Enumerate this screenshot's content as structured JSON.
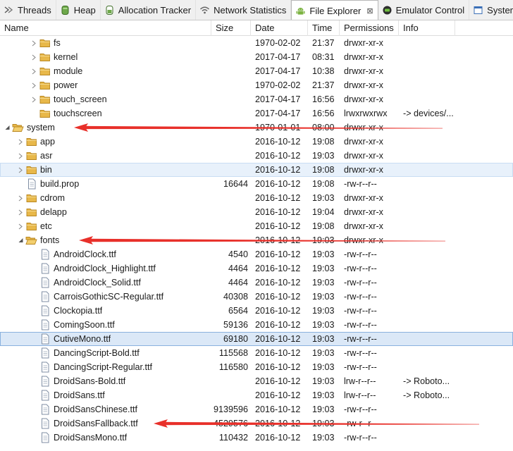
{
  "tabs": [
    {
      "label": "Threads",
      "icon": "threads-icon",
      "active": false,
      "closable": false
    },
    {
      "label": "Heap",
      "icon": "heap-icon",
      "active": false,
      "closable": false
    },
    {
      "label": "Allocation Tracker",
      "icon": "allocation-tracker-icon",
      "active": false,
      "closable": false
    },
    {
      "label": "Network Statistics",
      "icon": "wifi-icon",
      "active": false,
      "closable": false
    },
    {
      "label": "File Explorer",
      "icon": "android-icon",
      "active": true,
      "closable": true,
      "close_glyph": "⊠"
    },
    {
      "label": "Emulator Control",
      "icon": "emulator-icon",
      "active": false,
      "closable": false
    },
    {
      "label": "System Informati",
      "icon": "system-info-icon",
      "active": false,
      "closable": false
    }
  ],
  "columns": {
    "name": "Name",
    "size": "Size",
    "date": "Date",
    "time": "Time",
    "permissions": "Permissions",
    "info": "Info"
  },
  "rows": [
    {
      "name": "fs",
      "type": "folder",
      "depth": 2,
      "expand": "collapsed",
      "size": "",
      "date": "1970-02-02",
      "time": "21:37",
      "perm": "drwxr-xr-x",
      "info": ""
    },
    {
      "name": "kernel",
      "type": "folder",
      "depth": 2,
      "expand": "collapsed",
      "size": "",
      "date": "2017-04-17",
      "time": "08:31",
      "perm": "drwxr-xr-x",
      "info": ""
    },
    {
      "name": "module",
      "type": "folder",
      "depth": 2,
      "expand": "collapsed",
      "size": "",
      "date": "2017-04-17",
      "time": "10:38",
      "perm": "drwxr-xr-x",
      "info": ""
    },
    {
      "name": "power",
      "type": "folder",
      "depth": 2,
      "expand": "collapsed",
      "size": "",
      "date": "1970-02-02",
      "time": "21:37",
      "perm": "drwxr-xr-x",
      "info": ""
    },
    {
      "name": "touch_screen",
      "type": "folder",
      "depth": 2,
      "expand": "collapsed",
      "size": "",
      "date": "2017-04-17",
      "time": "16:56",
      "perm": "drwxr-xr-x",
      "info": ""
    },
    {
      "name": "touchscreen",
      "type": "folder",
      "depth": 2,
      "expand": "none",
      "size": "",
      "date": "2017-04-17",
      "time": "16:56",
      "perm": "lrwxrwxrwx",
      "info": "-> devices/..."
    },
    {
      "name": "system",
      "type": "folder",
      "depth": 0,
      "expand": "expanded",
      "size": "",
      "date": "1970-01-01",
      "time": "08:00",
      "perm": "drwxr-xr-x",
      "info": ""
    },
    {
      "name": "app",
      "type": "folder",
      "depth": 1,
      "expand": "collapsed",
      "size": "",
      "date": "2016-10-12",
      "time": "19:08",
      "perm": "drwxr-xr-x",
      "info": ""
    },
    {
      "name": "asr",
      "type": "folder",
      "depth": 1,
      "expand": "collapsed",
      "size": "",
      "date": "2016-10-12",
      "time": "19:03",
      "perm": "drwxr-xr-x",
      "info": ""
    },
    {
      "name": "bin",
      "type": "folder",
      "depth": 1,
      "expand": "collapsed",
      "size": "",
      "date": "2016-10-12",
      "time": "19:08",
      "perm": "drwxr-xr-x",
      "info": "",
      "highlight": "hover"
    },
    {
      "name": "build.prop",
      "type": "file",
      "depth": 1,
      "expand": "none",
      "size": "16644",
      "date": "2016-10-12",
      "time": "19:08",
      "perm": "-rw-r--r--",
      "info": ""
    },
    {
      "name": "cdrom",
      "type": "folder",
      "depth": 1,
      "expand": "collapsed",
      "size": "",
      "date": "2016-10-12",
      "time": "19:03",
      "perm": "drwxr-xr-x",
      "info": ""
    },
    {
      "name": "delapp",
      "type": "folder",
      "depth": 1,
      "expand": "collapsed",
      "size": "",
      "date": "2016-10-12",
      "time": "19:04",
      "perm": "drwxr-xr-x",
      "info": ""
    },
    {
      "name": "etc",
      "type": "folder",
      "depth": 1,
      "expand": "collapsed",
      "size": "",
      "date": "2016-10-12",
      "time": "19:08",
      "perm": "drwxr-xr-x",
      "info": ""
    },
    {
      "name": "fonts",
      "type": "folder",
      "depth": 1,
      "expand": "expanded",
      "size": "",
      "date": "2016-10-12",
      "time": "19:03",
      "perm": "drwxr-xr-x",
      "info": ""
    },
    {
      "name": "AndroidClock.ttf",
      "type": "file",
      "depth": 2,
      "expand": "none",
      "size": "4540",
      "date": "2016-10-12",
      "time": "19:03",
      "perm": "-rw-r--r--",
      "info": ""
    },
    {
      "name": "AndroidClock_Highlight.ttf",
      "type": "file",
      "depth": 2,
      "expand": "none",
      "size": "4464",
      "date": "2016-10-12",
      "time": "19:03",
      "perm": "-rw-r--r--",
      "info": ""
    },
    {
      "name": "AndroidClock_Solid.ttf",
      "type": "file",
      "depth": 2,
      "expand": "none",
      "size": "4464",
      "date": "2016-10-12",
      "time": "19:03",
      "perm": "-rw-r--r--",
      "info": ""
    },
    {
      "name": "CarroisGothicSC-Regular.ttf",
      "type": "file",
      "depth": 2,
      "expand": "none",
      "size": "40308",
      "date": "2016-10-12",
      "time": "19:03",
      "perm": "-rw-r--r--",
      "info": ""
    },
    {
      "name": "Clockopia.ttf",
      "type": "file",
      "depth": 2,
      "expand": "none",
      "size": "6564",
      "date": "2016-10-12",
      "time": "19:03",
      "perm": "-rw-r--r--",
      "info": ""
    },
    {
      "name": "ComingSoon.ttf",
      "type": "file",
      "depth": 2,
      "expand": "none",
      "size": "59136",
      "date": "2016-10-12",
      "time": "19:03",
      "perm": "-rw-r--r--",
      "info": ""
    },
    {
      "name": "CutiveMono.ttf",
      "type": "file",
      "depth": 2,
      "expand": "none",
      "size": "69180",
      "date": "2016-10-12",
      "time": "19:03",
      "perm": "-rw-r--r--",
      "info": "",
      "highlight": "selected"
    },
    {
      "name": "DancingScript-Bold.ttf",
      "type": "file",
      "depth": 2,
      "expand": "none",
      "size": "115568",
      "date": "2016-10-12",
      "time": "19:03",
      "perm": "-rw-r--r--",
      "info": ""
    },
    {
      "name": "DancingScript-Regular.ttf",
      "type": "file",
      "depth": 2,
      "expand": "none",
      "size": "116580",
      "date": "2016-10-12",
      "time": "19:03",
      "perm": "-rw-r--r--",
      "info": ""
    },
    {
      "name": "DroidSans-Bold.ttf",
      "type": "file",
      "depth": 2,
      "expand": "none",
      "size": "",
      "date": "2016-10-12",
      "time": "19:03",
      "perm": "lrw-r--r--",
      "info": "-> Roboto..."
    },
    {
      "name": "DroidSans.ttf",
      "type": "file",
      "depth": 2,
      "expand": "none",
      "size": "",
      "date": "2016-10-12",
      "time": "19:03",
      "perm": "lrw-r--r--",
      "info": "-> Roboto..."
    },
    {
      "name": "DroidSansChinese.ttf",
      "type": "file",
      "depth": 2,
      "expand": "none",
      "size": "9139596",
      "date": "2016-10-12",
      "time": "19:03",
      "perm": "-rw-r--r--",
      "info": ""
    },
    {
      "name": "DroidSansFallback.ttf",
      "type": "file",
      "depth": 2,
      "expand": "none",
      "size": "4529576",
      "date": "2016-10-12",
      "time": "19:03",
      "perm": "-rw-r--r--",
      "info": ""
    },
    {
      "name": "DroidSansMono.ttf",
      "type": "file",
      "depth": 2,
      "expand": "none",
      "size": "110432",
      "date": "2016-10-12",
      "time": "19:03",
      "perm": "-rw-r--r--",
      "info": ""
    }
  ],
  "annotations": {
    "arrow_color": "#e8302a",
    "arrow_targets": [
      "system",
      "fonts",
      "DroidSansFallback.ttf"
    ]
  },
  "colors": {
    "folder": "#e8b84a",
    "folder_dark": "#b8861f",
    "android_green": "#7cb342",
    "selection": "#dbe8f7",
    "hover": "#e8f1fb"
  }
}
